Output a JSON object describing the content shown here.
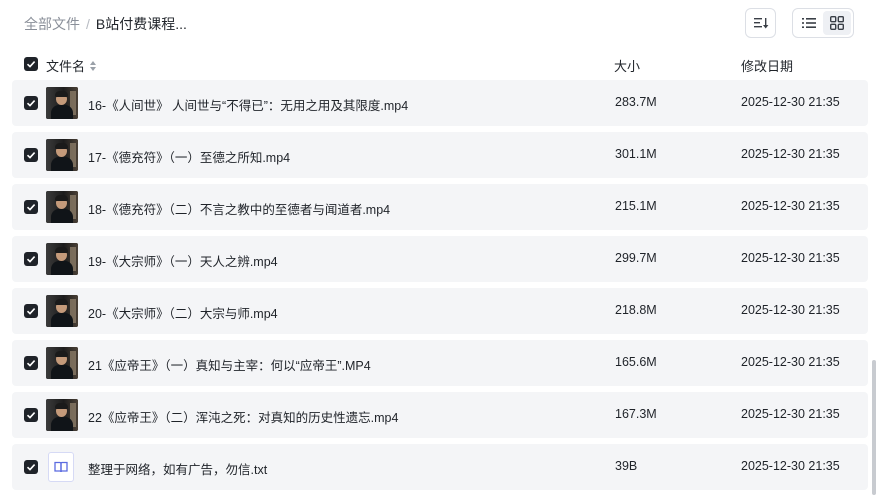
{
  "breadcrumb": {
    "root": "全部文件",
    "separator": "/",
    "current": "B站付费课程..."
  },
  "toolbar": {
    "sort_icon": "sort-icon",
    "list_view_icon": "list-view-icon",
    "grid_view_icon": "grid-view-icon",
    "active_view": "list"
  },
  "columns": {
    "name": "文件名",
    "size": "大小",
    "date": "修改日期"
  },
  "files": [
    {
      "name": "16-《人间世》 人间世与“不得已”：无用之用及其限度.mp4",
      "size": "283.7M",
      "date": "2025-12-30 21:35",
      "type": "video"
    },
    {
      "name": "17-《德充符》（一）至德之所知.mp4",
      "size": "301.1M",
      "date": "2025-12-30 21:35",
      "type": "video"
    },
    {
      "name": "18-《德充符》（二）不言之教中的至德者与闻道者.mp4",
      "size": "215.1M",
      "date": "2025-12-30 21:35",
      "type": "video"
    },
    {
      "name": "19-《大宗师》（一）天人之辨.mp4",
      "size": "299.7M",
      "date": "2025-12-30 21:35",
      "type": "video"
    },
    {
      "name": "20-《大宗师》（二）大宗与师.mp4",
      "size": "218.8M",
      "date": "2025-12-30 21:35",
      "type": "video"
    },
    {
      "name": "21《应帝王》（一）真知与主宰：何以“应帝王”.MP4",
      "size": "165.6M",
      "date": "2025-12-30 21:35",
      "type": "video"
    },
    {
      "name": "22《应帝王》（二）浑沌之死：对真知的历史性遗忘.mp4",
      "size": "167.3M",
      "date": "2025-12-30 21:35",
      "type": "video"
    },
    {
      "name": "整理于网络，如有广告，勿信.txt",
      "size": "39B",
      "date": "2025-12-30 21:35",
      "type": "txt"
    }
  ],
  "colors": {
    "row_bg": "#f4f5f7",
    "checkbox": "#1f2329",
    "doc_icon": "#5b6be0"
  }
}
